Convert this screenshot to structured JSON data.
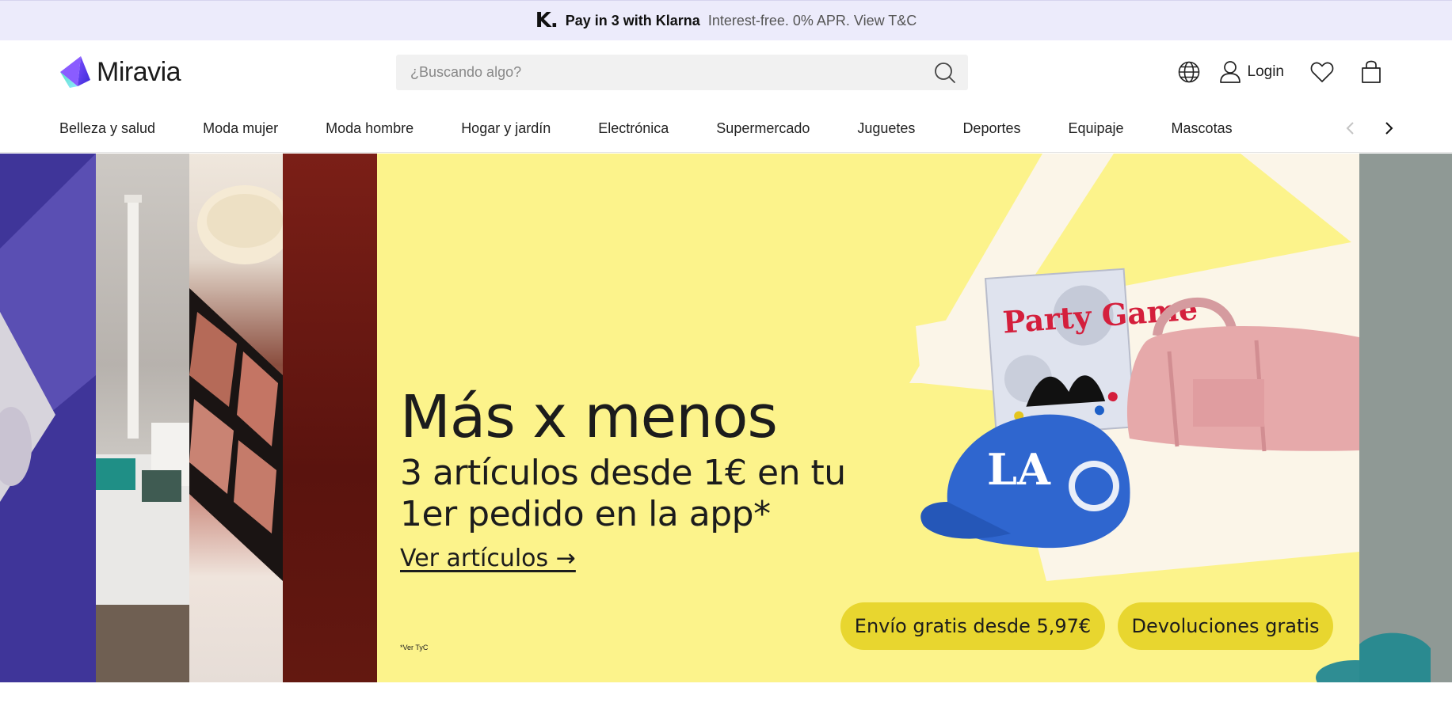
{
  "klarna": {
    "logo": "K.",
    "strong": "Pay in 3 with Klarna",
    "light": "Interest-free. 0% APR. View T&C"
  },
  "header": {
    "logo_text": "Miravia",
    "search_placeholder": "¿Buscando algo?",
    "login_label": "Login",
    "icons": [
      "globe-icon",
      "user-icon",
      "heart-icon",
      "bag-icon"
    ]
  },
  "categories": [
    "Belleza y salud",
    "Moda mujer",
    "Moda hombre",
    "Hogar y jardín",
    "Electrónica",
    "Supermercado",
    "Juguetes",
    "Deportes",
    "Equipaje",
    "Mascotas"
  ],
  "hero": {
    "title": "Más x menos",
    "subtitle": "3 artículos desde 1€ en tu 1er pedido en la app*",
    "link": "Ver artículos →",
    "fine_print": "*Ver TyC",
    "pill_shipping": "Envío gratis desde 5,97€",
    "pill_returns": "Devoluciones gratis",
    "product_box_text": "Party Game",
    "cap_text": "LA",
    "colors": {
      "background": "#fcf38b",
      "pill": "#e8d62f",
      "brand": "#6a3df0"
    }
  }
}
